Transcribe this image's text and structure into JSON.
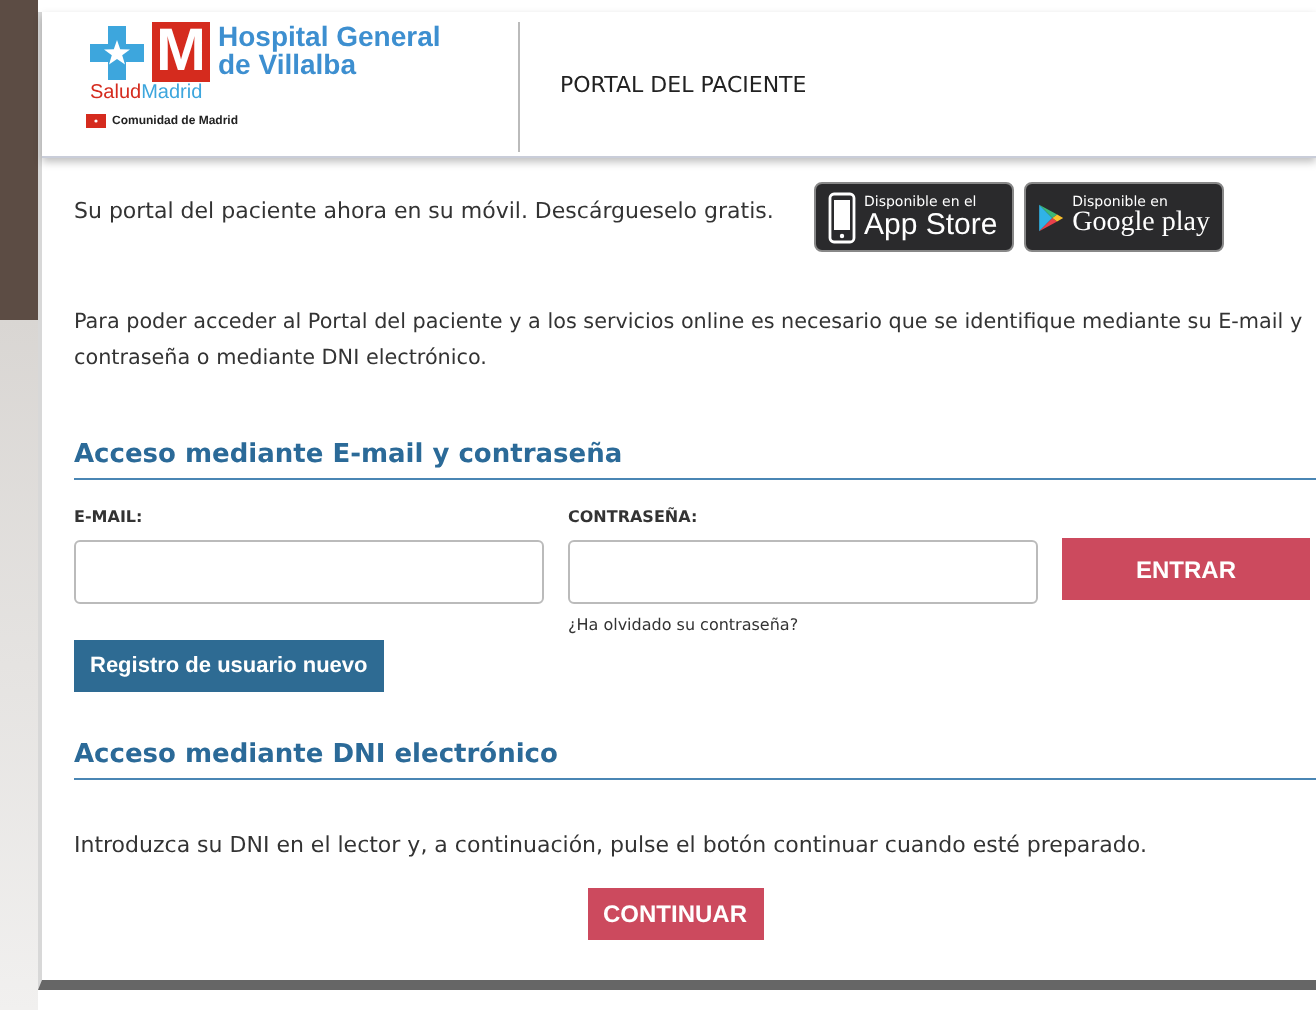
{
  "header": {
    "logo": {
      "mark": "M",
      "name_line1": "Hospital General",
      "name_line2": "de Villalba",
      "brand_prefix": "Salud",
      "brand_suffix": "Madrid",
      "region": "Comunidad de Madrid"
    },
    "title": "PORTAL DEL PACIENTE"
  },
  "app_promo": {
    "text": "Su portal del paciente ahora en su móvil. Descárgueselo gratis.",
    "badges": [
      {
        "kind": "apple",
        "caption": "Disponible en el",
        "store": "App Store"
      },
      {
        "kind": "google",
        "caption": "Disponible en",
        "store": "Google play"
      }
    ]
  },
  "intro": "Para poder acceder al Portal del paciente y a los servicios online es necesario que se identifique mediante su E-mail y contraseña o mediante DNI electrónico.",
  "email_login": {
    "heading": "Acceso mediante E-mail y contraseña",
    "fields": [
      {
        "label": "E-MAIL:"
      },
      {
        "label": "CONTRASEÑA:",
        "link": "¿Ha olvidado su contraseña?"
      }
    ],
    "submit": "ENTRAR",
    "register": "Registro de usuario nuevo"
  },
  "dni_login": {
    "heading": "Acceso mediante DNI electrónico",
    "text": "Introduzca su DNI en el lector y, a continuación, pulse el botón continuar cuando esté preparado.",
    "button": "CONTINUAR"
  }
}
